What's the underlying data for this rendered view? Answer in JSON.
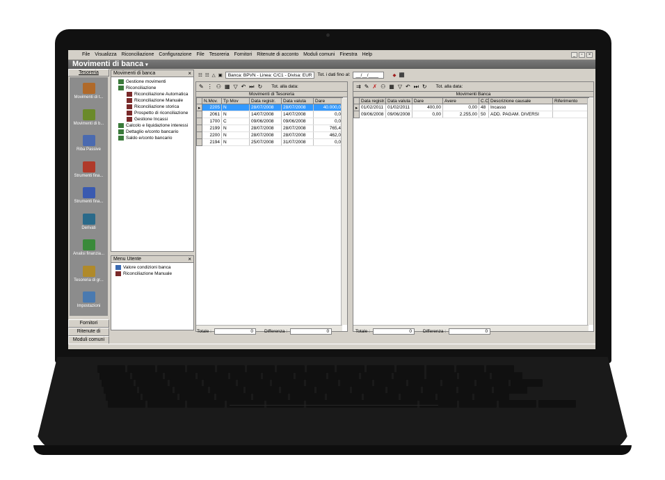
{
  "menubar": {
    "items": [
      "File",
      "Visualizza",
      "Riconciliazione",
      "Configurazione",
      "File",
      "Tesoreria",
      "Fornitori",
      "Ritenute di acconto",
      "Moduli comuni",
      "Finestra",
      "Help"
    ],
    "win_controls": [
      "_",
      "▫",
      "×"
    ]
  },
  "window": {
    "title": "Movimenti di banca",
    "title_arrow": "▾"
  },
  "leftbar": {
    "top_tab": "Tesoreria",
    "items": [
      {
        "label": "Movimenti di t...",
        "icon": "ledger-icon"
      },
      {
        "label": "Movimenti di b...",
        "icon": "bank-icon"
      },
      {
        "label": "Riba Passive",
        "icon": "envelope-icon"
      },
      {
        "label": "Strumenti fina...",
        "icon": "pen-icon"
      },
      {
        "label": "Strumenti fina...",
        "icon": "printer-icon"
      },
      {
        "label": "Derivati",
        "icon": "flask-icon"
      },
      {
        "label": "Analisi finanzia...",
        "icon": "chart-icon"
      },
      {
        "label": "Tesoreria di gr...",
        "icon": "globe-icon"
      },
      {
        "label": "Impostazioni",
        "icon": "calendar-icon"
      }
    ],
    "bottom_tabs": [
      "Fornitori",
      "Ritenute di acconto",
      "Moduli comuni"
    ]
  },
  "tree_panel": {
    "title": "Movimenti di banca",
    "close": "×",
    "items": [
      {
        "label": "Gestione movimenti",
        "level": 1
      },
      {
        "label": "Riconciliazione",
        "level": 1
      },
      {
        "label": "Riconciliazione Automatica",
        "level": 2
      },
      {
        "label": "Riconciliazione Manuale",
        "level": 2
      },
      {
        "label": "Riconciliazione storica",
        "level": 2
      },
      {
        "label": "Prospetto di riconciliazione",
        "level": 2
      },
      {
        "label": "Gestione Incassi",
        "level": 2
      },
      {
        "label": "Calcolo e liquidazione interessi",
        "level": 1
      },
      {
        "label": "Dettaglio e/conto bancario",
        "level": 1
      },
      {
        "label": "Saldo e/conto bancario",
        "level": 1
      }
    ]
  },
  "menu_utente": {
    "title": "Menu Utente",
    "close": "×",
    "items": [
      "Valore condizioni banca",
      "Riconciliazione Manuale"
    ]
  },
  "toolbar": {
    "bank_info": "Banca: BPVN - Linea: C/C1 - Divisa: EUR",
    "date_label": "Tot. i dati fino al:",
    "date_value": "__/__/____"
  },
  "tesoreria": {
    "tot_label": "Tot. alla data:",
    "caption": "Movimenti di Tesoreria",
    "columns": [
      "N.Mov.",
      "Tp Mov",
      "Data registr.",
      "Data valuta",
      "Dare"
    ],
    "rows": [
      [
        "2205",
        "N",
        "28/07/2008",
        "28/07/2008",
        "40.000,0"
      ],
      [
        "2061",
        "N",
        "14/07/2008",
        "14/07/2008",
        "0,0"
      ],
      [
        "1700",
        "C",
        "09/06/2008",
        "09/06/2008",
        "0,0"
      ],
      [
        "2199",
        "N",
        "28/07/2008",
        "28/07/2008",
        "765,4"
      ],
      [
        "2200",
        "N",
        "28/07/2008",
        "28/07/2008",
        "462,0"
      ],
      [
        "2194",
        "N",
        "25/07/2008",
        "31/07/2008",
        "0,0"
      ]
    ],
    "totale_label": "Totale :",
    "totale_value": "0",
    "diff_label": "Differenza :",
    "diff_value": "0"
  },
  "banca": {
    "tot_label": "Tot. alla data:",
    "caption": "Movimenti Banca",
    "columns": [
      "Data registr.",
      "Data valuta",
      "Dare",
      "Avere",
      "C.C.",
      "Descrizione causale",
      "Riferimento"
    ],
    "rows": [
      [
        "01/02/2011",
        "01/02/2011",
        "400,00",
        "0,00",
        "48",
        "Incasso",
        ""
      ],
      [
        "09/06/2008",
        "09/06/2008",
        "0,00",
        "2.255,00",
        "50",
        "ADD. PAGAM. DIVERSI",
        ""
      ]
    ],
    "totale_label": "Totale :",
    "totale_value": "0",
    "diff_label": "Differenza :",
    "diff_value": "0"
  }
}
